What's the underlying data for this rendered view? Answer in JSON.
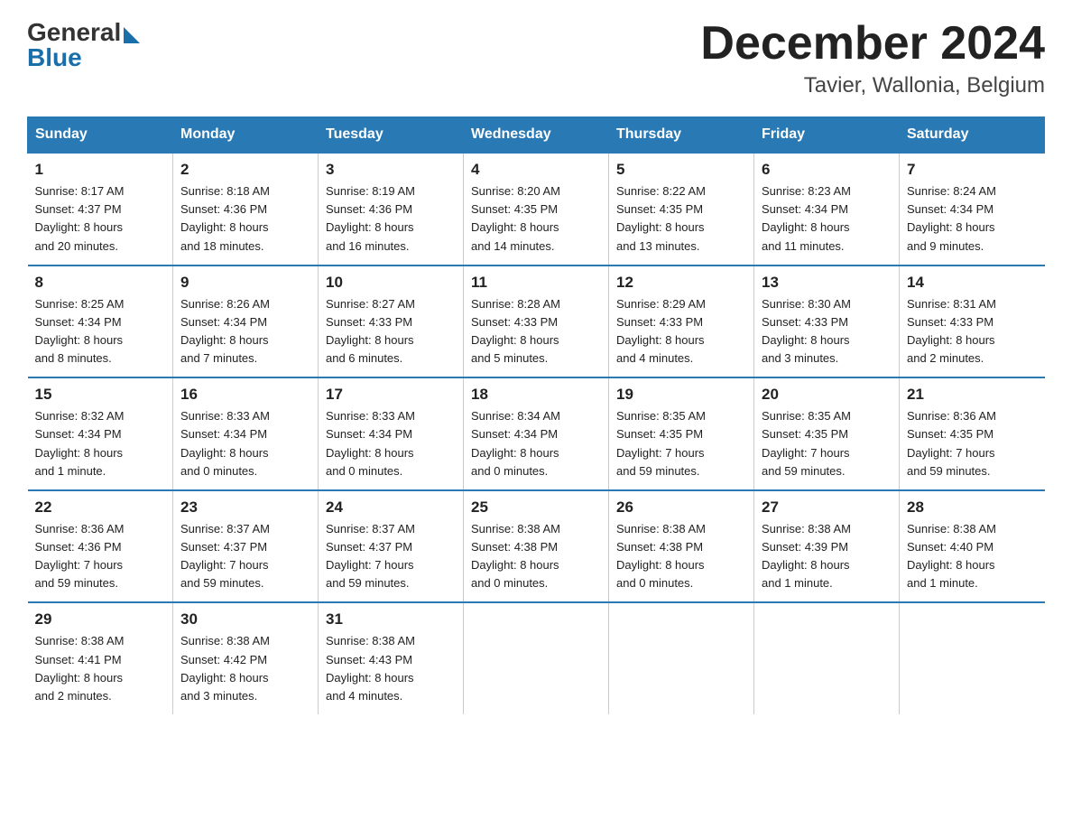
{
  "logo": {
    "general": "General",
    "blue": "Blue"
  },
  "title": "December 2024",
  "subtitle": "Tavier, Wallonia, Belgium",
  "days_of_week": [
    "Sunday",
    "Monday",
    "Tuesday",
    "Wednesday",
    "Thursday",
    "Friday",
    "Saturday"
  ],
  "weeks": [
    [
      {
        "day": "1",
        "info": "Sunrise: 8:17 AM\nSunset: 4:37 PM\nDaylight: 8 hours\nand 20 minutes."
      },
      {
        "day": "2",
        "info": "Sunrise: 8:18 AM\nSunset: 4:36 PM\nDaylight: 8 hours\nand 18 minutes."
      },
      {
        "day": "3",
        "info": "Sunrise: 8:19 AM\nSunset: 4:36 PM\nDaylight: 8 hours\nand 16 minutes."
      },
      {
        "day": "4",
        "info": "Sunrise: 8:20 AM\nSunset: 4:35 PM\nDaylight: 8 hours\nand 14 minutes."
      },
      {
        "day": "5",
        "info": "Sunrise: 8:22 AM\nSunset: 4:35 PM\nDaylight: 8 hours\nand 13 minutes."
      },
      {
        "day": "6",
        "info": "Sunrise: 8:23 AM\nSunset: 4:34 PM\nDaylight: 8 hours\nand 11 minutes."
      },
      {
        "day": "7",
        "info": "Sunrise: 8:24 AM\nSunset: 4:34 PM\nDaylight: 8 hours\nand 9 minutes."
      }
    ],
    [
      {
        "day": "8",
        "info": "Sunrise: 8:25 AM\nSunset: 4:34 PM\nDaylight: 8 hours\nand 8 minutes."
      },
      {
        "day": "9",
        "info": "Sunrise: 8:26 AM\nSunset: 4:34 PM\nDaylight: 8 hours\nand 7 minutes."
      },
      {
        "day": "10",
        "info": "Sunrise: 8:27 AM\nSunset: 4:33 PM\nDaylight: 8 hours\nand 6 minutes."
      },
      {
        "day": "11",
        "info": "Sunrise: 8:28 AM\nSunset: 4:33 PM\nDaylight: 8 hours\nand 5 minutes."
      },
      {
        "day": "12",
        "info": "Sunrise: 8:29 AM\nSunset: 4:33 PM\nDaylight: 8 hours\nand 4 minutes."
      },
      {
        "day": "13",
        "info": "Sunrise: 8:30 AM\nSunset: 4:33 PM\nDaylight: 8 hours\nand 3 minutes."
      },
      {
        "day": "14",
        "info": "Sunrise: 8:31 AM\nSunset: 4:33 PM\nDaylight: 8 hours\nand 2 minutes."
      }
    ],
    [
      {
        "day": "15",
        "info": "Sunrise: 8:32 AM\nSunset: 4:34 PM\nDaylight: 8 hours\nand 1 minute."
      },
      {
        "day": "16",
        "info": "Sunrise: 8:33 AM\nSunset: 4:34 PM\nDaylight: 8 hours\nand 0 minutes."
      },
      {
        "day": "17",
        "info": "Sunrise: 8:33 AM\nSunset: 4:34 PM\nDaylight: 8 hours\nand 0 minutes."
      },
      {
        "day": "18",
        "info": "Sunrise: 8:34 AM\nSunset: 4:34 PM\nDaylight: 8 hours\nand 0 minutes."
      },
      {
        "day": "19",
        "info": "Sunrise: 8:35 AM\nSunset: 4:35 PM\nDaylight: 7 hours\nand 59 minutes."
      },
      {
        "day": "20",
        "info": "Sunrise: 8:35 AM\nSunset: 4:35 PM\nDaylight: 7 hours\nand 59 minutes."
      },
      {
        "day": "21",
        "info": "Sunrise: 8:36 AM\nSunset: 4:35 PM\nDaylight: 7 hours\nand 59 minutes."
      }
    ],
    [
      {
        "day": "22",
        "info": "Sunrise: 8:36 AM\nSunset: 4:36 PM\nDaylight: 7 hours\nand 59 minutes."
      },
      {
        "day": "23",
        "info": "Sunrise: 8:37 AM\nSunset: 4:37 PM\nDaylight: 7 hours\nand 59 minutes."
      },
      {
        "day": "24",
        "info": "Sunrise: 8:37 AM\nSunset: 4:37 PM\nDaylight: 7 hours\nand 59 minutes."
      },
      {
        "day": "25",
        "info": "Sunrise: 8:38 AM\nSunset: 4:38 PM\nDaylight: 8 hours\nand 0 minutes."
      },
      {
        "day": "26",
        "info": "Sunrise: 8:38 AM\nSunset: 4:38 PM\nDaylight: 8 hours\nand 0 minutes."
      },
      {
        "day": "27",
        "info": "Sunrise: 8:38 AM\nSunset: 4:39 PM\nDaylight: 8 hours\nand 1 minute."
      },
      {
        "day": "28",
        "info": "Sunrise: 8:38 AM\nSunset: 4:40 PM\nDaylight: 8 hours\nand 1 minute."
      }
    ],
    [
      {
        "day": "29",
        "info": "Sunrise: 8:38 AM\nSunset: 4:41 PM\nDaylight: 8 hours\nand 2 minutes."
      },
      {
        "day": "30",
        "info": "Sunrise: 8:38 AM\nSunset: 4:42 PM\nDaylight: 8 hours\nand 3 minutes."
      },
      {
        "day": "31",
        "info": "Sunrise: 8:38 AM\nSunset: 4:43 PM\nDaylight: 8 hours\nand 4 minutes."
      },
      {
        "day": "",
        "info": ""
      },
      {
        "day": "",
        "info": ""
      },
      {
        "day": "",
        "info": ""
      },
      {
        "day": "",
        "info": ""
      }
    ]
  ]
}
